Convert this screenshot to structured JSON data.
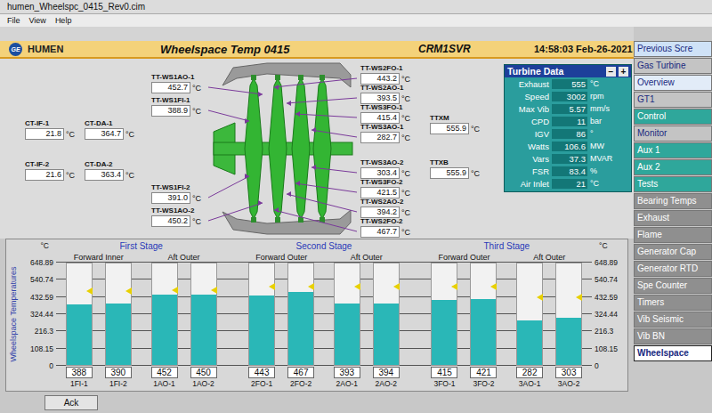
{
  "window": {
    "title": "humen_Wheelspc_0415_Rev0.cim"
  },
  "menu": [
    "File",
    "View",
    "Help"
  ],
  "header": {
    "logo": "GE",
    "site": "HUMEN",
    "title": "Wheelspace Temp 0415",
    "server": "CRM1SVR",
    "time": "14:58:03 Feb-26-2021"
  },
  "nav": [
    {
      "label": "Previous Scre",
      "color": "#cfe2f7",
      "selected": false
    },
    {
      "label": "Gas Turbine",
      "color": "#c4c4c4",
      "selected": false
    },
    {
      "label": "Overview",
      "color": "#e2ecf8",
      "selected": false
    },
    {
      "label": "GT1",
      "color": "#c4c4c4",
      "selected": false
    },
    {
      "label": "Control",
      "color": "#2fa79b",
      "selected": false
    },
    {
      "label": "Monitor",
      "color": "#c4c4c4",
      "selected": false
    },
    {
      "label": "Aux 1",
      "color": "#2fa79b",
      "selected": false
    },
    {
      "label": "Aux 2",
      "color": "#2fa79b",
      "selected": false
    },
    {
      "label": "Tests",
      "color": "#2fa79b",
      "selected": false
    },
    {
      "label": "Bearing Temps",
      "color": "#8f8f8f",
      "selected": false
    },
    {
      "label": "Exhaust",
      "color": "#8f8f8f",
      "selected": false
    },
    {
      "label": "Flame",
      "color": "#8f8f8f",
      "selected": false
    },
    {
      "label": "Generator Cap",
      "color": "#8f8f8f",
      "selected": false
    },
    {
      "label": "Generator RTD",
      "color": "#8f8f8f",
      "selected": false
    },
    {
      "label": "Spe Counter",
      "color": "#8f8f8f",
      "selected": false
    },
    {
      "label": "Timers",
      "color": "#8f8f8f",
      "selected": false
    },
    {
      "label": "Vib Seismic",
      "color": "#8f8f8f",
      "selected": false
    },
    {
      "label": "Vib BN",
      "color": "#8f8f8f",
      "selected": false
    },
    {
      "label": "Wheelspace",
      "color": "#ffffff",
      "selected": true
    }
  ],
  "diagram": {
    "wheelspace_left": [
      {
        "tag": "TT-WS1AO-1",
        "value": "452.7",
        "unit": "°C"
      },
      {
        "tag": "TT-WS1FI-1",
        "value": "388.9",
        "unit": "°C"
      },
      {
        "tag": "TT-WS1FI-2",
        "value": "391.0",
        "unit": "°C"
      },
      {
        "tag": "TT-WS1AO-2",
        "value": "450.2",
        "unit": "°C"
      }
    ],
    "cooling": [
      {
        "tag": "CT-IF-1",
        "value": "21.8",
        "unit": "°C"
      },
      {
        "tag": "CT-DA-1",
        "value": "364.7",
        "unit": "°C"
      },
      {
        "tag": "CT-IF-2",
        "value": "21.6",
        "unit": "°C"
      },
      {
        "tag": "CT-DA-2",
        "value": "363.4",
        "unit": "°C"
      }
    ],
    "wheelspace_right": [
      {
        "tag": "TT-WS2FO-1",
        "value": "443.2",
        "unit": "°C"
      },
      {
        "tag": "TT-WS2AO-1",
        "value": "393.5",
        "unit": "°C"
      },
      {
        "tag": "TT-WS3FO-1",
        "value": "415.4",
        "unit": "°C"
      },
      {
        "tag": "TT-WS3AO-1",
        "value": "282.7",
        "unit": "°C"
      },
      {
        "tag": "TT-WS3AO-2",
        "value": "303.4",
        "unit": "°C"
      },
      {
        "tag": "TT-WS3FO-2",
        "value": "421.5",
        "unit": "°C"
      },
      {
        "tag": "TT-WS2AO-2",
        "value": "394.2",
        "unit": "°C"
      },
      {
        "tag": "TT-WS2FO-2",
        "value": "467.7",
        "unit": "°C"
      }
    ],
    "exhaust": [
      {
        "tag": "TTXM",
        "value": "555.9",
        "unit": "°C"
      },
      {
        "tag": "TTXB",
        "value": "555.9",
        "unit": "°C"
      }
    ]
  },
  "turbine_data": {
    "title": "Turbine Data",
    "minus": "−",
    "plus": "+",
    "rows": [
      {
        "label": "Exhaust",
        "value": "555",
        "unit": "°C"
      },
      {
        "label": "Speed",
        "value": "3002",
        "unit": "rpm"
      },
      {
        "label": "Max Vib",
        "value": "5.57",
        "unit": "mm/s"
      },
      {
        "label": "CPD",
        "value": "11",
        "unit": "bar"
      },
      {
        "label": "IGV",
        "value": "86",
        "unit": "°"
      },
      {
        "label": "Watts",
        "value": "106.6",
        "unit": "MW"
      },
      {
        "label": "Vars",
        "value": "37.3",
        "unit": "MVAR"
      },
      {
        "label": "FSR",
        "value": "83.4",
        "unit": "%"
      },
      {
        "label": "Air Inlet",
        "value": "21",
        "unit": "°C"
      }
    ]
  },
  "chart": {
    "unit_left": "°C",
    "unit_right": "°C",
    "y_label": "Wheelspace Temperatures",
    "y_ticks_left": [
      "648.89",
      "540.74",
      "432.59",
      "324.44",
      "216.3",
      "108.15",
      "0"
    ],
    "y_ticks_right": [
      "648.89",
      "540.74",
      "432.59",
      "324.44",
      "216.3",
      "108.15",
      "0"
    ],
    "stages": [
      {
        "title": "First Stage",
        "positions": [
          {
            "label": "Forward Inner",
            "bars": [
              {
                "tag": "1FI-1",
                "reading": "388",
                "value": 388,
                "alarm": 470
              },
              {
                "tag": "1FI-2",
                "reading": "390",
                "value": 390,
                "alarm": 470
              }
            ]
          },
          {
            "label": "Aft Outer",
            "bars": [
              {
                "tag": "1AO-1",
                "reading": "452",
                "value": 452,
                "alarm": 480
              },
              {
                "tag": "1AO-2",
                "reading": "450",
                "value": 450,
                "alarm": 480
              }
            ]
          }
        ]
      },
      {
        "title": "Second Stage",
        "positions": [
          {
            "label": "Forward Outer",
            "bars": [
              {
                "tag": "2FO-1",
                "reading": "443",
                "value": 443,
                "alarm": 500
              },
              {
                "tag": "2FO-2",
                "reading": "467",
                "value": 467,
                "alarm": 500
              }
            ]
          },
          {
            "label": "Aft Outer",
            "bars": [
              {
                "tag": "2AO-1",
                "reading": "393",
                "value": 393,
                "alarm": 500
              },
              {
                "tag": "2AO-2",
                "reading": "394",
                "value": 394,
                "alarm": 500
              }
            ]
          }
        ]
      },
      {
        "title": "Third Stage",
        "positions": [
          {
            "label": "Forward Outer",
            "bars": [
              {
                "tag": "3FO-1",
                "reading": "415",
                "value": 415,
                "alarm": 500
              },
              {
                "tag": "3FO-2",
                "reading": "421",
                "value": 421,
                "alarm": 500
              }
            ]
          },
          {
            "label": "Aft Outer",
            "bars": [
              {
                "tag": "3AO-1",
                "reading": "282",
                "value": 282,
                "alarm": 430
              },
              {
                "tag": "3AO-2",
                "reading": "303",
                "value": 303,
                "alarm": 430
              }
            ]
          }
        ]
      }
    ]
  },
  "footer": {
    "buttons": [
      "Ack"
    ]
  }
}
